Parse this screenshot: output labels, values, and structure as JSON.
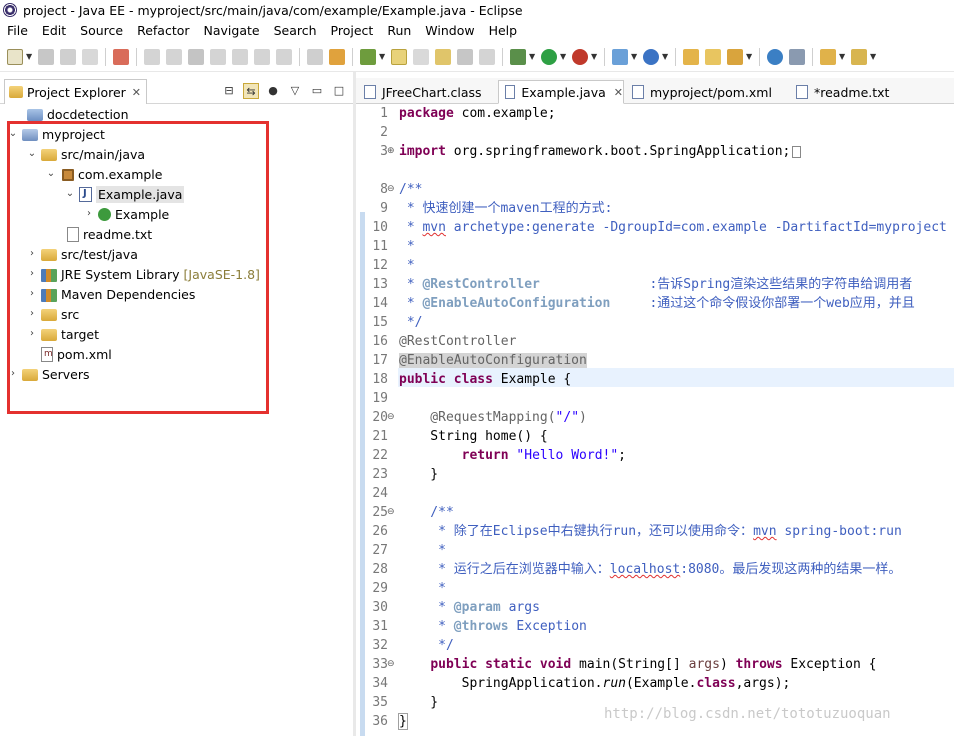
{
  "window": {
    "title": "project - Java EE - myproject/src/main/java/com/example/Example.java - Eclipse"
  },
  "menu": [
    "File",
    "Edit",
    "Source",
    "Refactor",
    "Navigate",
    "Search",
    "Project",
    "Run",
    "Window",
    "Help"
  ],
  "project_explorer": {
    "tab_label": "Project Explorer",
    "tree": [
      {
        "label": "docdetection",
        "icon": "folder-icon",
        "twisty": "",
        "depth": 1
      },
      {
        "label": "myproject",
        "icon": "project-icon",
        "twisty": "expanded",
        "depth": 0
      },
      {
        "label": "src/main/java",
        "icon": "source-folder-icon",
        "twisty": "expanded",
        "depth": 1
      },
      {
        "label": "com.example",
        "icon": "package-icon",
        "twisty": "expanded",
        "depth": 2
      },
      {
        "label": "Example.java",
        "icon": "java-file-icon",
        "twisty": "expanded",
        "depth": 3,
        "selected": true
      },
      {
        "label": "Example",
        "icon": "class-icon",
        "twisty": "collapsed",
        "depth": 4
      },
      {
        "label": "readme.txt",
        "icon": "text-file-icon",
        "twisty": "",
        "depth": 3
      },
      {
        "label": "src/test/java",
        "icon": "source-folder-icon",
        "twisty": "collapsed",
        "depth": 1
      },
      {
        "label": "JRE System Library",
        "decoration": "[JavaSE-1.8]",
        "icon": "library-icon",
        "twisty": "collapsed",
        "depth": 1
      },
      {
        "label": "Maven Dependencies",
        "icon": "library-icon",
        "twisty": "collapsed",
        "depth": 1
      },
      {
        "label": "src",
        "icon": "folder-icon",
        "twisty": "collapsed",
        "depth": 1
      },
      {
        "label": "target",
        "icon": "folder-icon",
        "twisty": "collapsed",
        "depth": 1
      },
      {
        "label": "pom.xml",
        "icon": "xml-file-icon",
        "twisty": "",
        "depth": 1
      },
      {
        "label": "Servers",
        "icon": "folder-icon",
        "twisty": "collapsed",
        "depth": 0
      }
    ]
  },
  "editor": {
    "tabs": [
      {
        "label": "JFreeChart.class",
        "active": false,
        "closable": false
      },
      {
        "label": "Example.java",
        "active": true,
        "closable": true
      },
      {
        "label": "myproject/pom.xml",
        "active": false,
        "closable": false
      },
      {
        "label": "*readme.txt",
        "active": false,
        "closable": false
      }
    ],
    "line_numbers": [
      "1",
      "2",
      "3",
      "8",
      "9",
      "10",
      "11",
      "12",
      "13",
      "14",
      "15",
      "16",
      "17",
      "18",
      "19",
      "20",
      "21",
      "22",
      "23",
      "24",
      "25",
      "26",
      "27",
      "28",
      "29",
      "30",
      "31",
      "32",
      "33",
      "34",
      "35",
      "36"
    ],
    "fold_markers": {
      "3": "⊕",
      "8": "⊖",
      "20": "⊖",
      "25": "⊖",
      "33": "⊖"
    },
    "code": {
      "l1": [
        "package",
        " com.example;"
      ],
      "l3": [
        "import",
        " org.springframework.boot.SpringApplication;"
      ],
      "l8": "/**",
      "l9": " * 快速创建一个maven工程的方式:",
      "l10": [
        " * ",
        "mvn",
        " archetype:generate -DgroupId=com.example -DartifactId=myproject"
      ],
      "l11": " *",
      "l12": " *",
      "l13": [
        " * ",
        "@RestController",
        "              :告诉Spring渲染这些结果的字符串给调用者"
      ],
      "l14": [
        " * ",
        "@EnableAutoConfiguration",
        "     :通过这个命令假设你部署一个web应用，并且"
      ],
      "l15": " */",
      "l16": "@RestController",
      "l17": "@EnableAutoConfiguration",
      "l18": [
        "public",
        " ",
        "class",
        " Example {"
      ],
      "l20": [
        "    @RequestMapping(",
        "\"/\"",
        ")"
      ],
      "l21": "    String home() {",
      "l22": [
        "        ",
        "return",
        " ",
        "\"Hello Word!\"",
        ";"
      ],
      "l23": "    }",
      "l25": "    /**",
      "l26": [
        "     * 除了在Eclipse中右键执行run，还可以使用命令：",
        "mvn",
        " spring-boot:run"
      ],
      "l27": "     *",
      "l28": [
        "     * 运行之后在浏览器中输入：",
        "localhost",
        ":8080。最后发现这两种的结果一样。"
      ],
      "l29": "     *",
      "l30": [
        "     * ",
        "@param",
        " args"
      ],
      "l31": [
        "     * ",
        "@throws",
        " Exception"
      ],
      "l32": "     */",
      "l33": [
        "    ",
        "public",
        " ",
        "static",
        " ",
        "void",
        " main(String[] ",
        "args",
        ") ",
        "throws",
        " Exception {"
      ],
      "l34": [
        "        SpringApplication.",
        "run",
        "(Example.",
        "class",
        ",args);"
      ],
      "l35": "    }",
      "l36": "}"
    }
  },
  "watermark": "http://blog.csdn.net/tototuzuoquan"
}
